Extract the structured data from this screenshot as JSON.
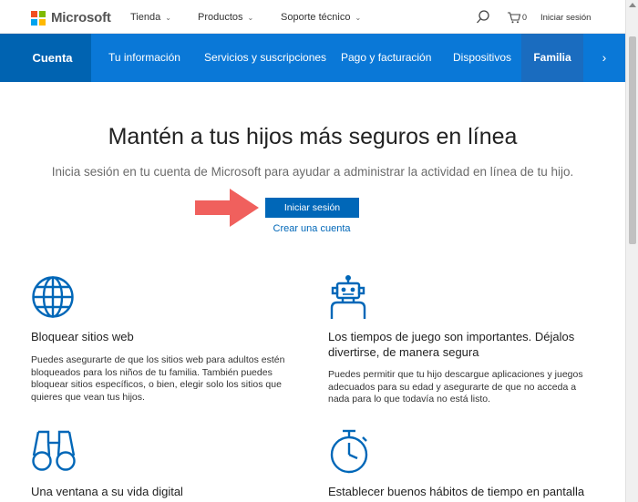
{
  "header": {
    "brand": "Microsoft",
    "nav": [
      {
        "label": "Tienda",
        "chevron": "⌄"
      },
      {
        "label": "Productos",
        "chevron": "⌄"
      },
      {
        "label": "Soporte técnico",
        "chevron": "⌄"
      }
    ],
    "cart_count": "0",
    "signin": "Iniciar sesión"
  },
  "subnav": {
    "account": "Cuenta",
    "items": [
      "Tu información",
      "Servicios y suscripciones",
      "Pago y facturación",
      "Dispositivos"
    ],
    "active": "Familia",
    "next_icon": "chevron-right-icon",
    "next_glyph": "›"
  },
  "hero": {
    "title": "Mantén a tus hijos más seguros en línea",
    "subtitle": "Inicia sesión en tu cuenta de Microsoft para ayudar a administrar la actividad en línea de tu hijo.",
    "signin_button": "Iniciar sesión",
    "create_link": "Crear una cuenta"
  },
  "features": [
    {
      "icon": "globe-icon",
      "title": "Bloquear sitios web",
      "text": [
        "Puedes asegurarte de que los sitios web para adultos estén",
        "bloqueados para los niños de tu familia. También puedes",
        "bloquear sitios específicos, o bien, elegir solo los sitios que",
        "quieres que vean tus hijos."
      ]
    },
    {
      "icon": "robot-icon",
      "title": [
        "Los tiempos de juego son importantes. Déjalos",
        "divertirse, de manera segura"
      ],
      "text": [
        "Puedes permitir que tu hijo descargue aplicaciones y juegos",
        "adecuados para su edad y asegurarte de que no acceda a",
        "nada para lo que todavía no está listo."
      ]
    },
    {
      "icon": "binoculars-icon",
      "title": "Una ventana a su vida digital"
    },
    {
      "icon": "stopwatch-icon",
      "title": "Establecer buenos hábitos de tiempo en pantalla"
    }
  ],
  "colors": {
    "brand_blue": "#0a78d7",
    "account_blue": "#0063b1",
    "button_blue": "#0067b8",
    "arrow_red": "#f0605d",
    "logo": [
      "#f25022",
      "#7fba00",
      "#00a4ef",
      "#ffb900"
    ]
  }
}
